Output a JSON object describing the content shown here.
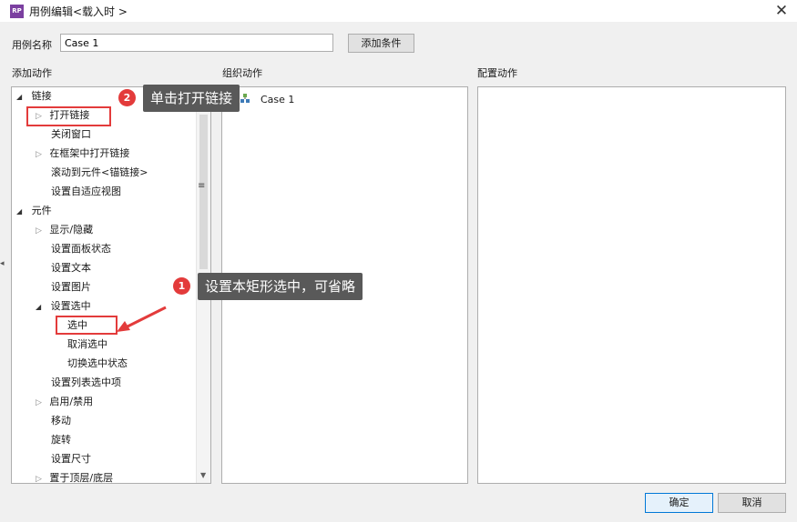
{
  "window": {
    "title": "用例编辑<载入时 >",
    "app_icon_text": "RP",
    "close_glyph": "✕",
    "accent_color": "#7b3fa0"
  },
  "case_name": {
    "label": "用例名称",
    "value": "Case 1",
    "add_condition_label": "添加条件"
  },
  "sections": {
    "add_actions": "添加动作",
    "organize_actions": "组织动作",
    "configure_actions": "配置动作"
  },
  "tree": {
    "link_group": "链接",
    "open_link": "打开链接",
    "close_window": "关闭窗口",
    "open_in_frame": "在框架中打开链接",
    "scroll_to": "滚动到元件<锚链接>",
    "set_adaptive": "设置自适应视图",
    "widget_group": "元件",
    "show_hide": "显示/隐藏",
    "set_panel_state": "设置面板状态",
    "set_text": "设置文本",
    "set_image": "设置图片",
    "set_selected": "设置选中",
    "selected": "选中",
    "deselect": "取消选中",
    "toggle_selected": "切换选中状态",
    "set_list_selected": "设置列表选中项",
    "enable_disable": "启用/禁用",
    "move": "移动",
    "rotate": "旋转",
    "set_size": "设置尺寸",
    "bring_front_back": "置于顶层/底层"
  },
  "organize": {
    "case_item": "Case 1"
  },
  "annotations": {
    "callout_2_number": "2",
    "callout_2_text": "单击打开链接",
    "callout_1_number": "1",
    "callout_1_text": "设置本矩形选中，可省略",
    "highlight_color": "#e33b3b"
  },
  "buttons": {
    "ok": "确定",
    "cancel": "取消"
  }
}
